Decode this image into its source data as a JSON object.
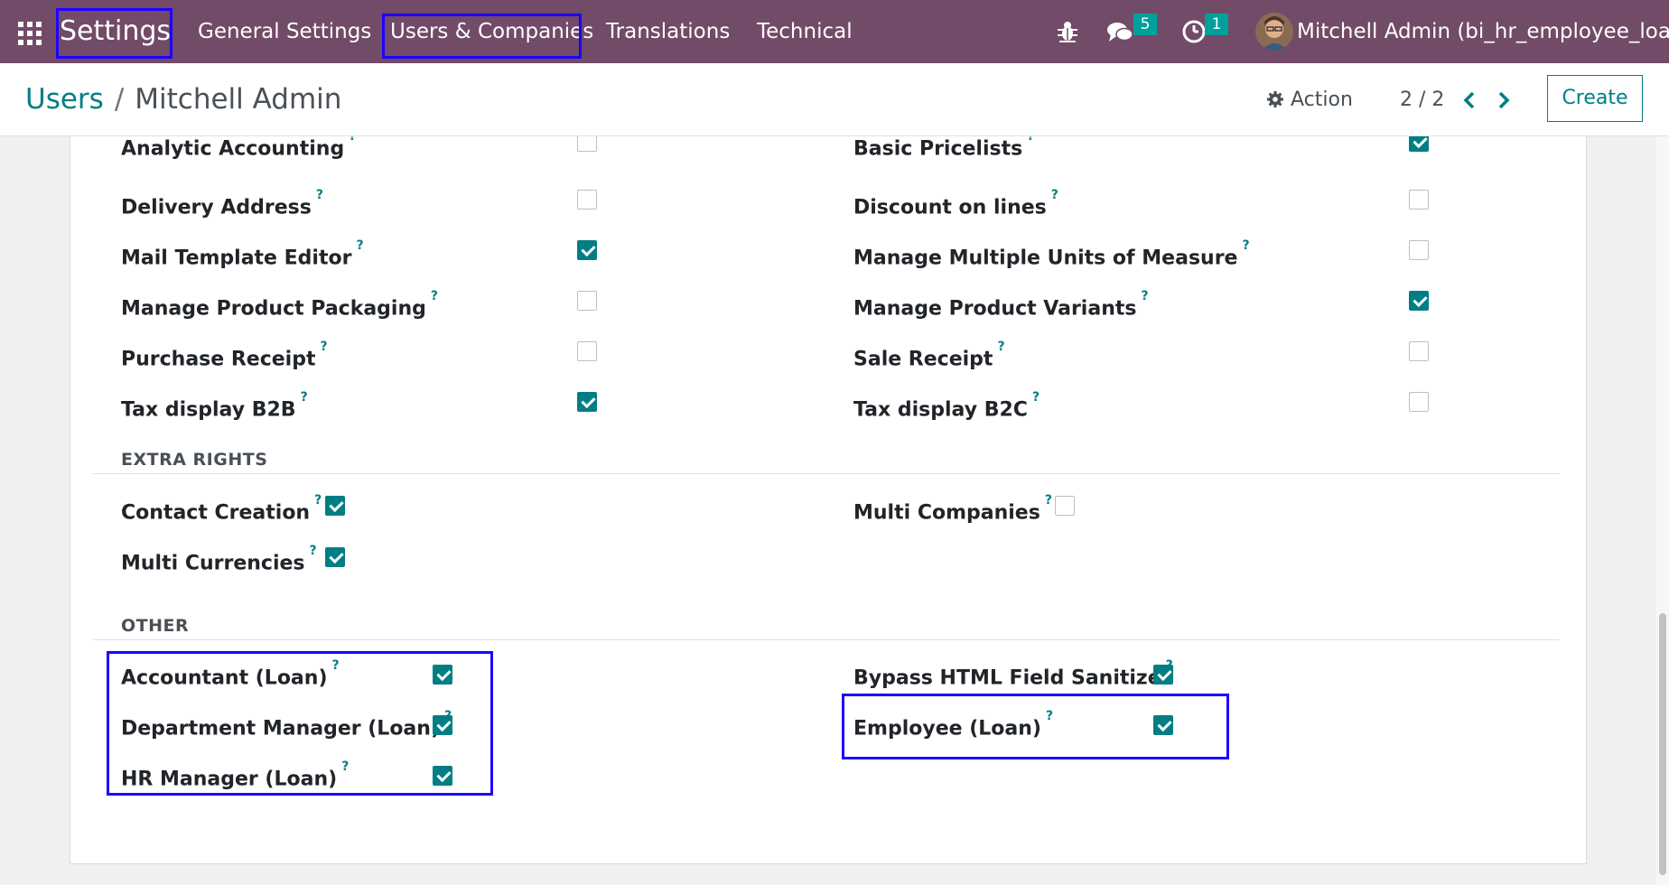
{
  "navbar": {
    "brand": "Settings",
    "menu": [
      "General Settings",
      "Users & Companies",
      "Translations",
      "Technical"
    ],
    "messages_count": "5",
    "activities_count": "1",
    "user": "Mitchell Admin (bi_hr_employee_loan)",
    "icons": [
      "apps-grid-icon",
      "bug-icon",
      "chat-icon",
      "clock-icon"
    ]
  },
  "control": {
    "crumb_parent": "Users",
    "crumb_sep": "/",
    "crumb_current": "Mitchell Admin",
    "action_label": "Action",
    "pager": "2 / 2",
    "create_label": "Create"
  },
  "technical": {
    "left": [
      {
        "label": "Analytic Accounting",
        "checked": false
      },
      {
        "label": "Delivery Address",
        "checked": false
      },
      {
        "label": "Mail Template Editor",
        "checked": true
      },
      {
        "label": "Manage Product Packaging",
        "checked": false
      },
      {
        "label": "Purchase Receipt",
        "checked": false
      },
      {
        "label": "Tax display B2B",
        "checked": true
      }
    ],
    "right": [
      {
        "label": "Basic Pricelists",
        "checked": true
      },
      {
        "label": "Discount on lines",
        "checked": false
      },
      {
        "label": "Manage Multiple Units of Measure",
        "checked": false
      },
      {
        "label": "Manage Product Variants",
        "checked": true
      },
      {
        "label": "Sale Receipt",
        "checked": false
      },
      {
        "label": "Tax display B2C",
        "checked": false
      }
    ]
  },
  "extra_rights": {
    "title": "EXTRA RIGHTS",
    "left": [
      {
        "label": "Contact Creation",
        "checked": true
      },
      {
        "label": "Multi Currencies",
        "checked": true
      }
    ],
    "right": [
      {
        "label": "Multi Companies",
        "checked": false
      }
    ]
  },
  "other": {
    "title": "OTHER",
    "left": [
      {
        "label": "Accountant (Loan)",
        "checked": true
      },
      {
        "label": "Department Manager (Loan)",
        "checked": true
      },
      {
        "label": "HR Manager (Loan)",
        "checked": true
      }
    ],
    "right": [
      {
        "label": "Bypass HTML Field Sanitize",
        "checked": true
      },
      {
        "label": "Employee (Loan)",
        "checked": true
      }
    ]
  },
  "help_mark": "?",
  "colors": {
    "navbar": "#714b67",
    "accent": "#017e84",
    "highlight": "#1e00ff"
  }
}
